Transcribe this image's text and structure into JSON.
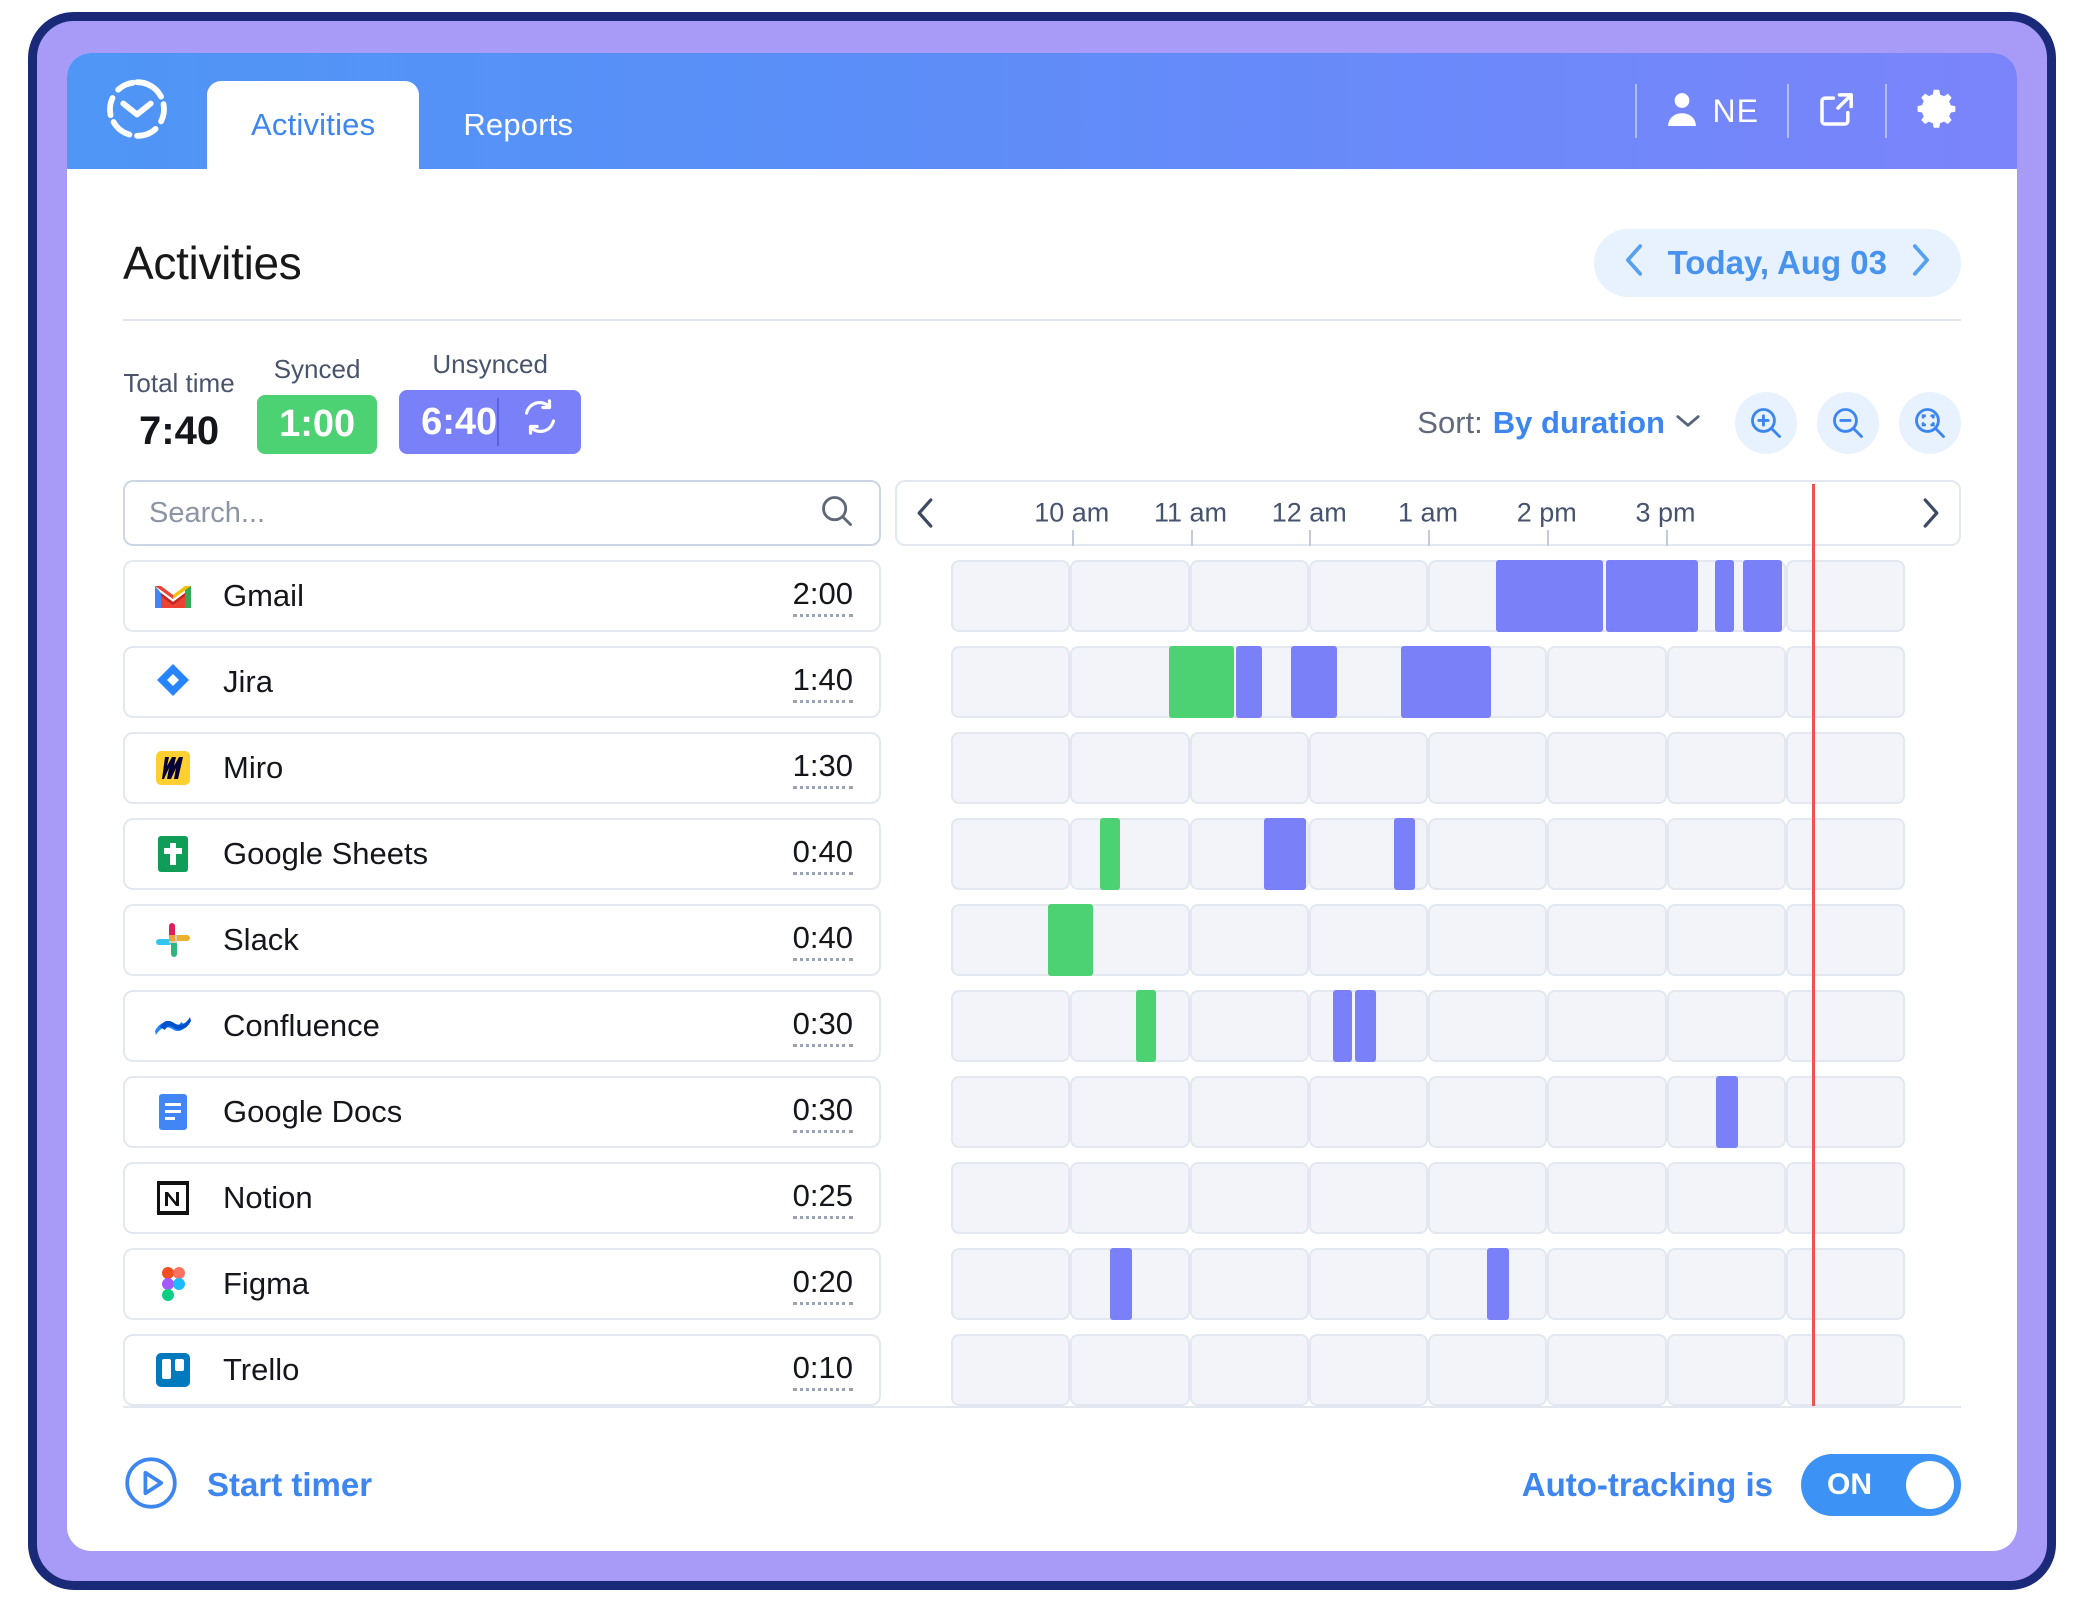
{
  "window": {
    "frame_color": "#a79bf7",
    "frame_border_color": "#1b2a78"
  },
  "topbar": {
    "logo_icon": "clock-logo-icon",
    "tabs": [
      {
        "label": "Activities",
        "active": true
      },
      {
        "label": "Reports",
        "active": false
      }
    ],
    "user_initials": "NE",
    "user_icon": "person-icon",
    "share_icon": "external-link-icon",
    "settings_icon": "gear-icon"
  },
  "page": {
    "title": "Activities",
    "date_nav": {
      "prev_icon": "chevron-left-icon",
      "label": "Today,  Aug 03",
      "next_icon": "chevron-right-icon"
    }
  },
  "stats": {
    "total": {
      "label": "Total time",
      "value": "7:40"
    },
    "synced": {
      "label": "Synced",
      "value": "1:00",
      "color": "#4cd173"
    },
    "unsynced": {
      "label": "Unsynced",
      "value": "6:40",
      "color": "#7a81f8",
      "sync_icon": "sync-refresh-icon"
    }
  },
  "sort": {
    "prefix": "Sort:",
    "value": "By duration",
    "chevron_icon": "chevron-down-icon",
    "buttons": [
      {
        "name": "zoom-in-button",
        "icon": "magnifier-plus-icon"
      },
      {
        "name": "zoom-out-button",
        "icon": "magnifier-minus-icon"
      },
      {
        "name": "zoom-fit-button",
        "icon": "magnifier-fit-icon"
      }
    ]
  },
  "search": {
    "placeholder": "Search...",
    "value": "",
    "icon": "search-icon"
  },
  "timeline": {
    "prev_icon": "chevron-left-icon",
    "next_icon": "chevron-right-icon",
    "ticks": [
      "10 am",
      "11 am",
      "12 am",
      "1 am",
      "2 pm",
      "3 pm"
    ],
    "now_marker_color": "#ef5350",
    "now_position_pct": 90.2,
    "legend": {
      "synced_color": "#4cd173",
      "unsynced_color": "#7a81f8"
    }
  },
  "chart_data": {
    "type": "timeline",
    "title": "Activities",
    "xlabel": "",
    "ylabel": "",
    "axis_ticks": [
      "10 am",
      "11 am",
      "12 am",
      "1 am",
      "2 pm",
      "3 pm"
    ],
    "slot_count": 8,
    "series": [
      {
        "name": "Gmail",
        "duration": "2:00",
        "icon": "gmail-icon",
        "segments": [
          {
            "start_pct": 57.1,
            "width_pct": 11.2,
            "state": "unsynced"
          },
          {
            "start_pct": 68.7,
            "width_pct": 9.6,
            "state": "unsynced"
          },
          {
            "start_pct": 80.1,
            "width_pct": 2.0,
            "state": "unsynced"
          },
          {
            "start_pct": 83.0,
            "width_pct": 4.1,
            "state": "unsynced"
          }
        ]
      },
      {
        "name": "Jira",
        "duration": "1:40",
        "icon": "jira-icon",
        "segments": [
          {
            "start_pct": 22.8,
            "width_pct": 6.9,
            "state": "synced"
          },
          {
            "start_pct": 29.9,
            "width_pct": 2.7,
            "state": "unsynced"
          },
          {
            "start_pct": 35.6,
            "width_pct": 4.9,
            "state": "unsynced"
          },
          {
            "start_pct": 47.2,
            "width_pct": 9.4,
            "state": "unsynced"
          }
        ]
      },
      {
        "name": "Miro",
        "duration": "1:30",
        "icon": "miro-icon",
        "segments": []
      },
      {
        "name": "Google Sheets",
        "duration": "0:40",
        "icon": "google-sheets-icon",
        "segments": [
          {
            "start_pct": 15.6,
            "width_pct": 2.1,
            "state": "synced"
          },
          {
            "start_pct": 32.8,
            "width_pct": 4.4,
            "state": "unsynced"
          },
          {
            "start_pct": 46.4,
            "width_pct": 2.2,
            "state": "unsynced"
          }
        ]
      },
      {
        "name": "Slack",
        "duration": "0:40",
        "icon": "slack-icon",
        "segments": [
          {
            "start_pct": 10.2,
            "width_pct": 4.7,
            "state": "synced"
          }
        ]
      },
      {
        "name": "Confluence",
        "duration": "0:30",
        "icon": "confluence-icon",
        "segments": [
          {
            "start_pct": 19.4,
            "width_pct": 2.1,
            "state": "synced"
          },
          {
            "start_pct": 40.0,
            "width_pct": 2.0,
            "state": "unsynced"
          },
          {
            "start_pct": 42.4,
            "width_pct": 2.2,
            "state": "unsynced"
          }
        ]
      },
      {
        "name": "Google Docs",
        "duration": "0:30",
        "icon": "google-docs-icon",
        "segments": [
          {
            "start_pct": 80.2,
            "width_pct": 2.3,
            "state": "unsynced"
          }
        ]
      },
      {
        "name": "Notion",
        "duration": "0:25",
        "icon": "notion-icon",
        "segments": []
      },
      {
        "name": "Figma",
        "duration": "0:20",
        "icon": "figma-icon",
        "segments": [
          {
            "start_pct": 16.7,
            "width_pct": 2.3,
            "state": "unsynced"
          },
          {
            "start_pct": 56.2,
            "width_pct": 2.3,
            "state": "unsynced"
          }
        ]
      },
      {
        "name": "Trello",
        "duration": "0:10",
        "icon": "trello-icon",
        "segments": []
      }
    ]
  },
  "footer": {
    "start_timer": {
      "label": "Start timer",
      "icon": "play-circle-icon"
    },
    "auto_tracking": {
      "label": "Auto-tracking is",
      "state": "ON"
    }
  }
}
